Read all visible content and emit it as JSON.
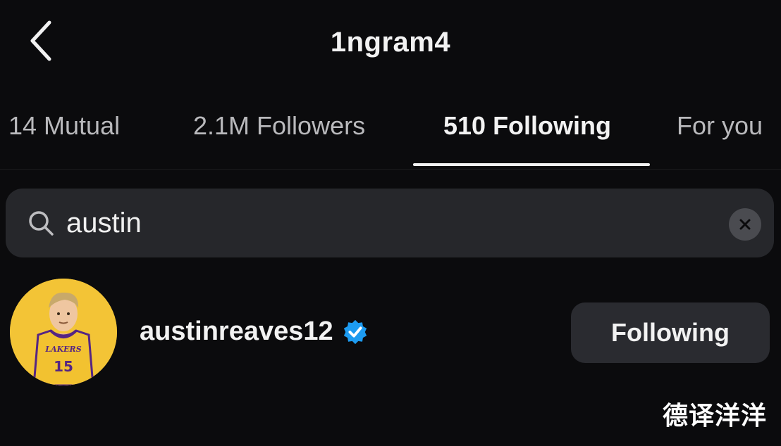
{
  "header": {
    "title": "1ngram4",
    "back_icon": "chevron-left-icon"
  },
  "tabs": [
    {
      "label": "14 Mutual",
      "active": false
    },
    {
      "label": "2.1M Followers",
      "active": false
    },
    {
      "label": "510 Following",
      "active": true
    },
    {
      "label": "For you",
      "active": false
    }
  ],
  "search": {
    "value": "austin",
    "icon": "search-icon",
    "clear_icon": "close-icon"
  },
  "results": [
    {
      "username": "austinreaves12",
      "verified": true,
      "button_label": "Following",
      "avatar_jersey_text": "LAKERS",
      "avatar_jersey_number": "15"
    }
  ],
  "watermark": "德译洋洋",
  "colors": {
    "background": "#0b0b0d",
    "search_bg": "#26272b",
    "button_bg": "#2a2b30",
    "verified_blue": "#1d9bf0",
    "avatar_yellow": "#f3c436",
    "jersey_gold": "#f2c230",
    "jersey_purple": "#552583"
  }
}
